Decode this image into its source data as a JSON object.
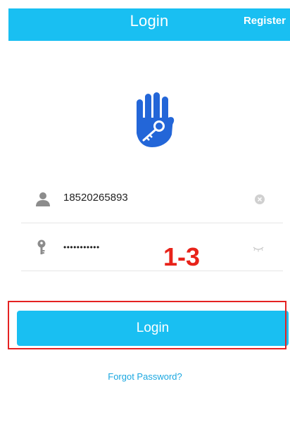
{
  "header": {
    "title": "Login",
    "register_label": "Register"
  },
  "form": {
    "username_value": "18520265893",
    "password_value": "•••••••••••",
    "login_label": "Login",
    "forgot_label": "Forgot Password?"
  },
  "annotation": {
    "step_label": "1-3"
  },
  "colors": {
    "accent": "#19bff2",
    "annotation": "#e52222",
    "logo_hand": "#2366d8"
  },
  "icons": {
    "logo": "hand-key-logo-icon",
    "user": "user-icon",
    "password": "key-icon",
    "clear": "clear-input-icon",
    "visibility": "eye-closed-icon"
  }
}
